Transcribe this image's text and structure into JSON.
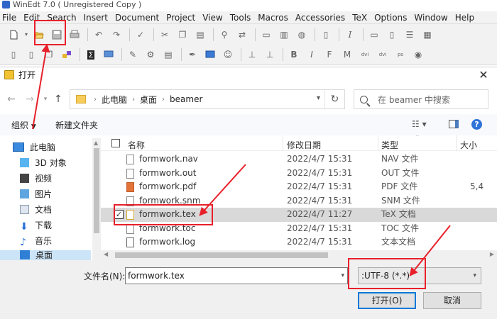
{
  "app": {
    "title": "WinEdt 7.0  ( Unregistered  Copy )"
  },
  "menu": [
    "File",
    "Edit",
    "Search",
    "Insert",
    "Document",
    "Project",
    "View",
    "Tools",
    "Macros",
    "Accessories",
    "TeX",
    "Options",
    "Window",
    "Help"
  ],
  "dialog": {
    "title": "打开",
    "breadcrumb": [
      "此电脑",
      "桌面",
      "beamer"
    ],
    "search_placeholder": "在 beamer 中搜索",
    "organize": "组织",
    "new_folder": "新建文件夹",
    "columns": {
      "name": "名称",
      "date": "修改日期",
      "type": "类型",
      "size": "大小"
    },
    "nav_tree": [
      {
        "label": "此电脑",
        "icon": "computer-icon"
      },
      {
        "label": "3D 对象",
        "icon": "3d-objects-icon"
      },
      {
        "label": "视频",
        "icon": "video-icon"
      },
      {
        "label": "图片",
        "icon": "picture-icon"
      },
      {
        "label": "文档",
        "icon": "document-icon"
      },
      {
        "label": "下载",
        "icon": "download-icon"
      },
      {
        "label": "音乐",
        "icon": "music-icon"
      },
      {
        "label": "桌面",
        "icon": "desktop-icon"
      }
    ],
    "files": [
      {
        "name": "formwork.nav",
        "date": "2022/4/7 15:31",
        "type": "NAV 文件",
        "size": ""
      },
      {
        "name": "formwork.out",
        "date": "2022/4/7 15:31",
        "type": "OUT 文件",
        "size": ""
      },
      {
        "name": "formwork.pdf",
        "date": "2022/4/7 15:31",
        "type": "PDF 文件",
        "size": "5,4"
      },
      {
        "name": "formwork.snm",
        "date": "2022/4/7 15:31",
        "type": "SNM 文件",
        "size": ""
      },
      {
        "name": "formwork.tex",
        "date": "2022/4/7 11:27",
        "type": "TeX 文档",
        "size": ""
      },
      {
        "name": "formwork.toc",
        "date": "2022/4/7 15:31",
        "type": "TOC 文件",
        "size": ""
      },
      {
        "name": "formwork.log",
        "date": "2022/4/7 15:31",
        "type": "文本文档",
        "size": ""
      }
    ],
    "filename_label": "文件名(N):",
    "filename_value": "formwork.tex",
    "encoding_value": ":UTF-8 (*.*)",
    "open_button": "打开(O)",
    "cancel_button": "取消"
  },
  "colors": {
    "annotation": "#e8202a",
    "selection": "#d9d9d9",
    "accent": "#0078d7"
  }
}
